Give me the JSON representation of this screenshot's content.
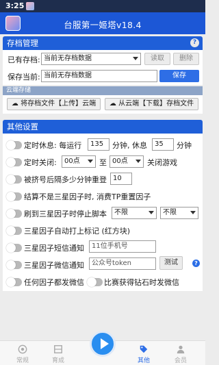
{
  "status": {
    "time": "3:25"
  },
  "header": {
    "title": "台服第一姬塔v18.4"
  },
  "archive": {
    "title": "存档管理",
    "existing_label": "已有存档:",
    "existing_value": "当前无存档数据",
    "read_label": "读取",
    "delete_label": "删除",
    "save_current_label": "保存当前:",
    "save_current_value": "当前无存档数据",
    "save_label": "保存"
  },
  "cloud": {
    "title": "云端存储",
    "upload_label": "将存档文件【上传】云端",
    "download_label": "从云端【下载】存档文件"
  },
  "other": {
    "title": "其他设置",
    "timed_rest": {
      "label1": "定时休息: 每运行",
      "run_minutes": "135",
      "label2": "分钟, 休息",
      "rest_minutes": "35",
      "label3": "分钟"
    },
    "timed_close": {
      "label1": "定时关闭:",
      "from": "00点",
      "to_label": "至",
      "to": "00点",
      "label2": "关闭游戏"
    },
    "restart": {
      "label": "被挤号后隔多少分钟重登",
      "value": "10"
    },
    "settlement": {
      "label": "结算不是三星因子时, 消费TP重置因子"
    },
    "stop_script": {
      "label": "刷到三星因子时停止脚本",
      "opt1": "不限",
      "opt2": "不限"
    },
    "auto_mark": {
      "label": "三星因子自动打上标记 (红方块)"
    },
    "sms": {
      "label": "三星因子短信通知",
      "placeholder": "11位手机号"
    },
    "wechat": {
      "label": "三星因子微信通知",
      "placeholder": "公众号token",
      "test_label": "测试"
    },
    "any_wechat": {
      "label": "任何因子都发微信"
    },
    "diamond_wechat": {
      "label": "比赛获得钻石时发微信"
    }
  },
  "nav": {
    "items": [
      "常规",
      "育成",
      "其他",
      "会员"
    ]
  }
}
